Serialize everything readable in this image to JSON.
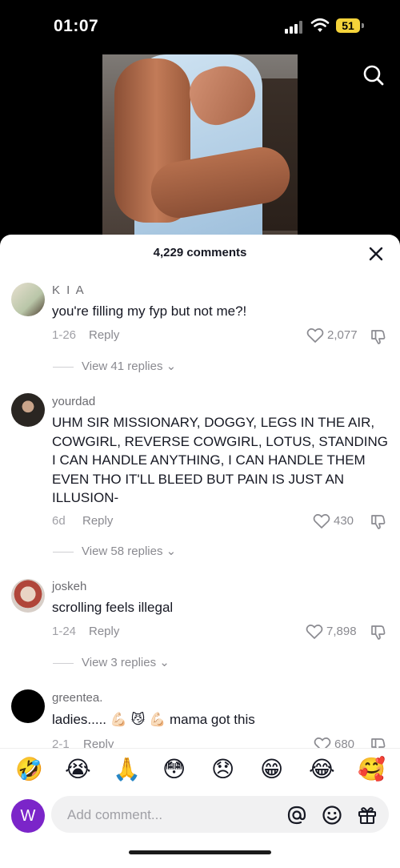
{
  "status_bar": {
    "time": "01:07",
    "battery": "51"
  },
  "sheet": {
    "title": "4,229 comments"
  },
  "comments": [
    {
      "username": "K I A",
      "text": "you're filling my fyp but not me?!",
      "date": "1-26",
      "reply": "Reply",
      "likes": "2,077",
      "view_replies": "View 41 replies"
    },
    {
      "username": "yourdad",
      "text": "UHM SIR MISSIONARY, DOGGY, LEGS IN THE AIR, COWGIRL, REVERSE COWGIRL, LOTUS, STANDING I CAN HANDLE ANYTHING, I CAN HANDLE THEM EVEN THO IT'LL BLEED BUT PAIN IS JUST AN ILLUSION-",
      "date": "6d",
      "reply": "Reply",
      "likes": "430",
      "view_replies": "View 58 replies"
    },
    {
      "username": "joskeh",
      "text": "scrolling feels illegal",
      "date": "1-24",
      "reply": "Reply",
      "likes": "7,898",
      "view_replies": "View 3 replies"
    },
    {
      "username": "greentea.",
      "text": "ladies..... 💪🏻 😼 💪🏻 mama got this",
      "date": "2-1",
      "reply": "Reply",
      "likes": "680"
    }
  ],
  "emoji_bar": [
    "🤣",
    "😭",
    "🙏",
    "😳",
    "😞",
    "😁",
    "😂",
    "🥰"
  ],
  "composer": {
    "avatar_letter": "W",
    "placeholder": "Add comment..."
  }
}
